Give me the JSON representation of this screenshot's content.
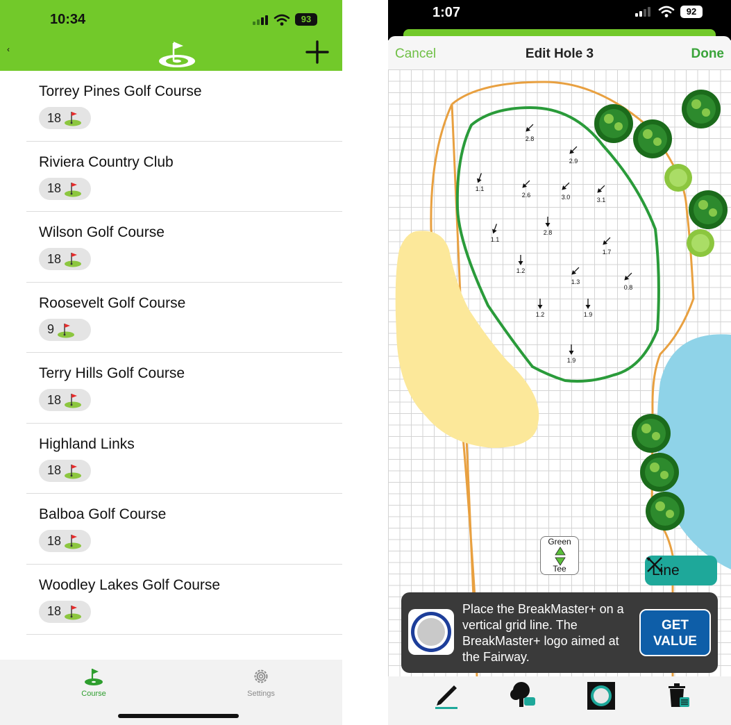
{
  "left": {
    "status": {
      "time": "10:34",
      "battery": "93"
    },
    "courses": [
      {
        "name": "Torrey Pines Golf Course",
        "holes": "18"
      },
      {
        "name": "Riviera Country Club",
        "holes": "18"
      },
      {
        "name": "Wilson Golf Course",
        "holes": "18"
      },
      {
        "name": "Roosevelt Golf Course",
        "holes": "9"
      },
      {
        "name": "Terry Hills Golf Course",
        "holes": "18"
      },
      {
        "name": "Highland Links",
        "holes": "18"
      },
      {
        "name": "Balboa Golf Course",
        "holes": "18"
      },
      {
        "name": "Woodley Lakes Golf Course",
        "holes": "18"
      }
    ],
    "tabs": {
      "course": "Course",
      "settings": "Settings"
    },
    "colors": {
      "header": "#72c92a",
      "active_tab": "#2e9e2e"
    }
  },
  "right": {
    "status": {
      "time": "1:07",
      "battery": "92"
    },
    "nav": {
      "cancel": "Cancel",
      "title": "Edit Hole 3",
      "done": "Done"
    },
    "slopes": [
      {
        "v": "2.8",
        "dir": 225
      },
      {
        "v": "2.9",
        "dir": 225
      },
      {
        "v": "1.1",
        "dir": 200
      },
      {
        "v": "2.6",
        "dir": 225
      },
      {
        "v": "3.0",
        "dir": 225
      },
      {
        "v": "3.1",
        "dir": 225
      },
      {
        "v": "1.1",
        "dir": 200
      },
      {
        "v": "2.8",
        "dir": 180
      },
      {
        "v": "1.7",
        "dir": 225
      },
      {
        "v": "1.2",
        "dir": 180
      },
      {
        "v": "1.3",
        "dir": 225
      },
      {
        "v": "0.8",
        "dir": 225
      },
      {
        "v": "1.2",
        "dir": 180
      },
      {
        "v": "1.9",
        "dir": 180
      },
      {
        "v": "1.9",
        "dir": 180
      }
    ],
    "orient": {
      "top": "Green",
      "bottom": "Tee"
    },
    "line_button": "Line",
    "tip": {
      "text": "Place the BreakMaster+ on a vertical grid line. The BreakMaster+ logo aimed at the Fairway.",
      "button": "GET VALUE"
    },
    "toolbar": [
      "pencil-tool",
      "tree-tool",
      "green-tool",
      "trash-tool"
    ],
    "colors": {
      "fairway_edge": "#e8a040",
      "green_edge": "#2a9b3a",
      "bunker": "#fce89a",
      "water": "#8fd3e8",
      "tip_button": "#0e5ea8"
    }
  }
}
